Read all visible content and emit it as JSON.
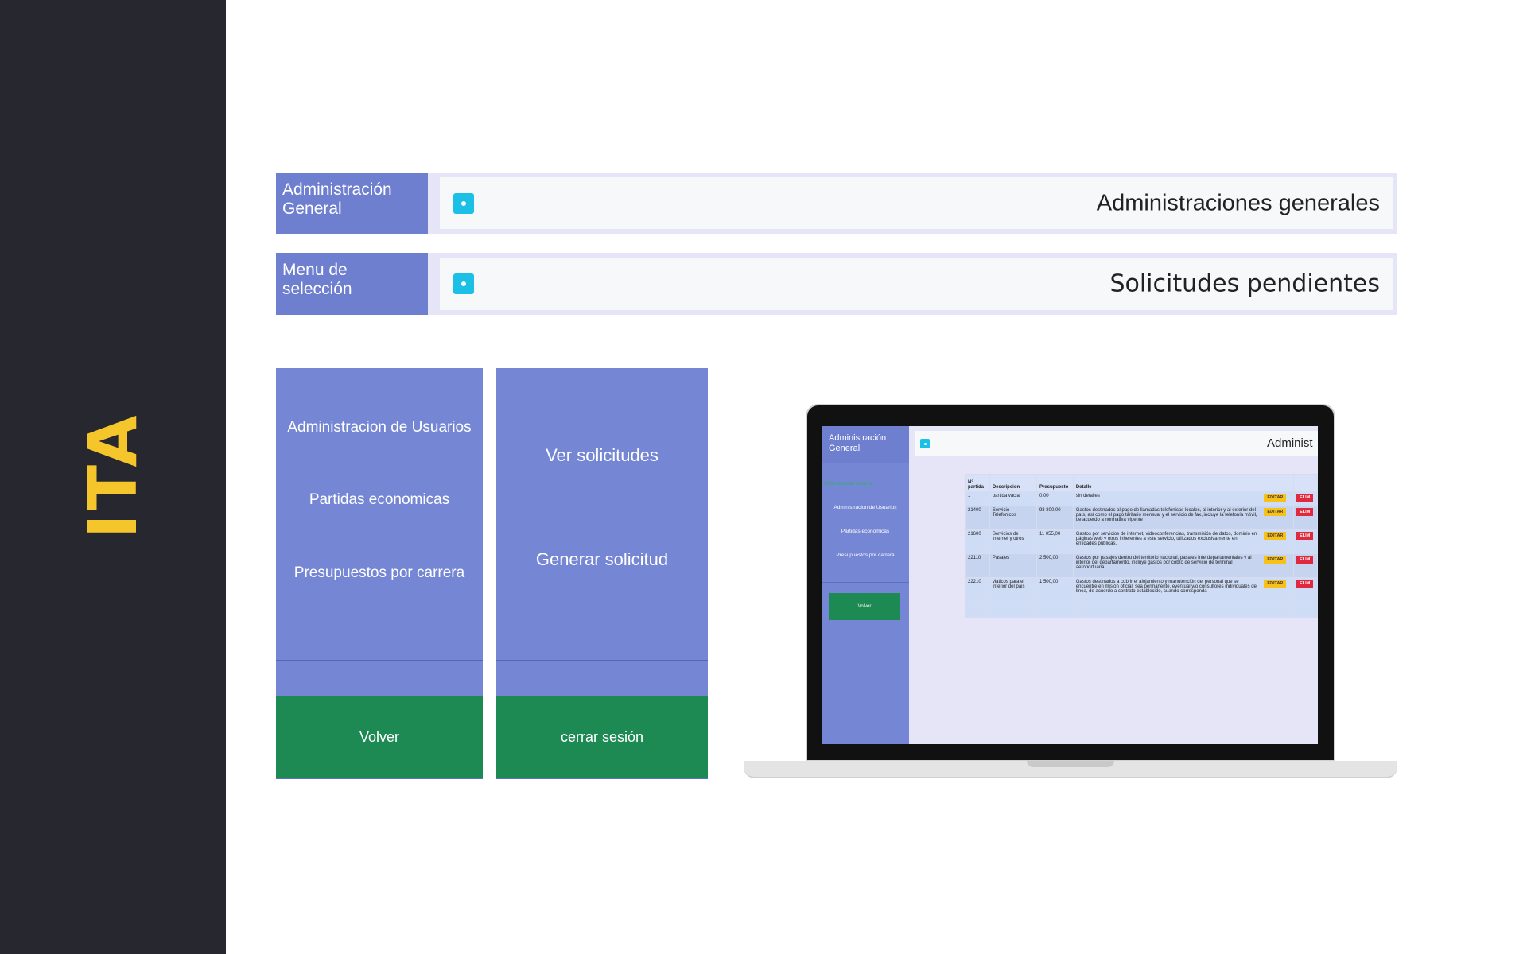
{
  "side": {
    "title": "ITA"
  },
  "header1": {
    "label": "Administración General",
    "title": "Administraciones generales"
  },
  "header2": {
    "label": "Menu de selección",
    "title": "Solicitudes pendientes"
  },
  "panel1": {
    "items": [
      "Administracion de Usuarios",
      "Partidas economicas",
      "Presupuestos por carrera"
    ],
    "footer": "Volver"
  },
  "panel2": {
    "items": [
      "Ver solicitudes",
      "Generar solicitud"
    ],
    "footer": "cerrar sesión"
  },
  "screen": {
    "brand": "Administración General",
    "active_link": "Administración General",
    "links": [
      "Administracion de Usuarios",
      "Partidas economicas",
      "Presupuestos por carrera"
    ],
    "back_button": "Volver",
    "title": "Administ",
    "table": {
      "headers": [
        "N° partida",
        "Descripcion",
        "Presupuesto",
        "Detalle",
        "",
        ""
      ],
      "edit_label": "EDITAR",
      "delete_label": "ELIM",
      "rows": [
        {
          "partida": "1",
          "descripcion": "partida vacia",
          "presupuesto": "0.00",
          "detalle": "sin detalles"
        },
        {
          "partida": "21400",
          "descripcion": "Servicio Telefónicos",
          "presupuesto": "93 800,00",
          "detalle": "Gastos destinados al pago de llamadas telefónicas locales, al interior y al exterior del país, así como el pago tarifario mensual y el servicio de fax, incluye la telefonía móvil, de acuerdo a normativa vigente"
        },
        {
          "partida": "21600",
          "descripcion": "Servicios de internet y otros",
          "presupuesto": "11 055,00",
          "detalle": "Gastos por servicios de internet, videoconferencias, transmisión de datos, dominio en páginas web y otros inherentes a este servicio, utilizados exclusivamente en entidades públicas."
        },
        {
          "partida": "22110",
          "descripcion": "Pasajes",
          "presupuesto": "2 500,00",
          "detalle": "Gastos por pasajes dentro del territorio nacional, pasajes interdepartamentales y al interior del departamento, incluye gastos por cobro de servicio de terminal aeroportuaria."
        },
        {
          "partida": "22210",
          "descripcion": "viaticos para el interior del pais",
          "presupuesto": "1 500,00",
          "detalle": "Gastos destinados a cubrir el alojamiento y manutención del personal que se encuentre en misión oficial, sea permanente, eventual y/o consultores individuales de línea, de acuerdo a contrato establecido, cuando corresponda"
        }
      ]
    }
  },
  "colors": {
    "sidebar_dark": "#27272f",
    "title_yellow": "#f5c62c",
    "panel_blue": "#7586d4",
    "label_blue": "#6f7fcf",
    "button_green": "#1d8a53",
    "icon_cyan": "#1cc0e6",
    "edit_yellow": "#f7c11a",
    "delete_red": "#e0283f"
  }
}
